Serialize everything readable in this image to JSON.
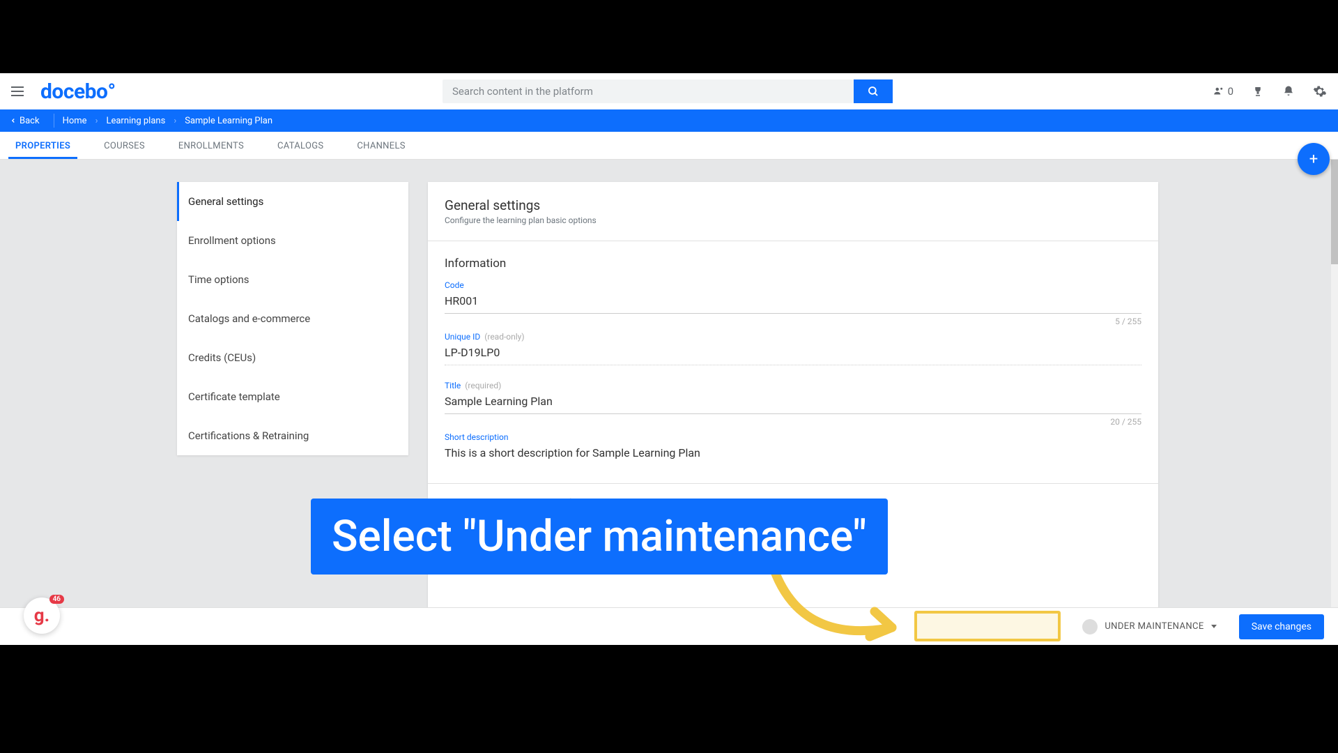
{
  "header": {
    "logo": "docebo",
    "search_placeholder": "Search content in the platform",
    "credits_count": "0"
  },
  "breadcrumb": {
    "back": "Back",
    "items": [
      "Home",
      "Learning plans",
      "Sample Learning Plan"
    ]
  },
  "tabs": [
    "PROPERTIES",
    "COURSES",
    "ENROLLMENTS",
    "CATALOGS",
    "CHANNELS"
  ],
  "sidebar": {
    "items": [
      "General settings",
      "Enrollment options",
      "Time options",
      "Catalogs and e-commerce",
      "Credits (CEUs)",
      "Certificate template",
      "Certifications & Retraining"
    ]
  },
  "panel": {
    "title": "General settings",
    "subtitle": "Configure the learning plan basic options",
    "section_info": "Information",
    "fields": {
      "code": {
        "label": "Code",
        "value": "HR001",
        "counter": "5 / 255"
      },
      "unique_id": {
        "label": "Unique ID",
        "hint": "(read-only)",
        "value": "LP-D19LP0"
      },
      "title": {
        "label": "Title",
        "hint": "(required)",
        "value": "Sample Learning Plan",
        "counter": "20 / 255"
      },
      "short_desc": {
        "label": "Short description",
        "value": "This is a short description for Sample Learning Plan"
      }
    },
    "rte_text": "This is a short description for Sample Learning Plan"
  },
  "footer": {
    "status": "UNDER MAINTENANCE",
    "save": "Save changes"
  },
  "annotation": {
    "text": "Select \"Under maintenance\""
  },
  "guidde": {
    "glyph": "g.",
    "badge": "46"
  }
}
